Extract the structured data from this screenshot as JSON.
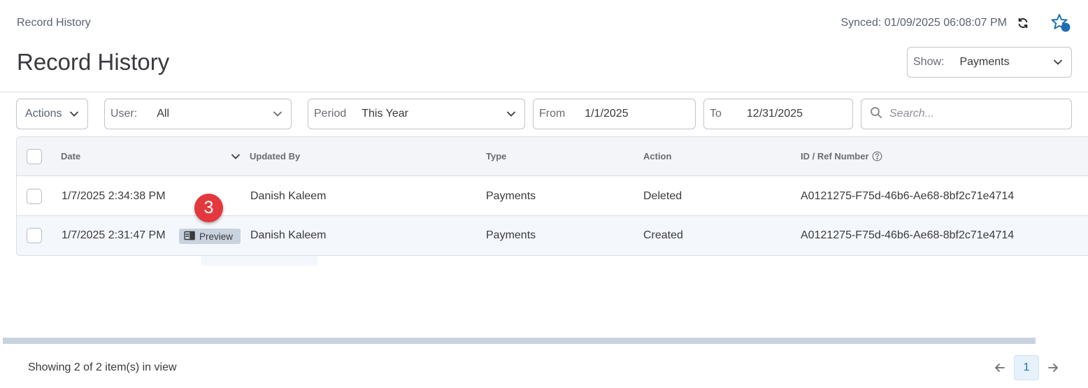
{
  "header": {
    "breadcrumb": "Record History",
    "synced": "Synced: 01/09/2025 06:08:07 PM",
    "title": "Record History"
  },
  "show": {
    "label": "Show:",
    "value": "Payments"
  },
  "filters": {
    "actions": "Actions",
    "user_label": "User:",
    "user_value": "All",
    "period_label": "Period",
    "period_value": "This Year",
    "from_label": "From",
    "from_value": "1/1/2025",
    "to_label": "To",
    "to_value": "12/31/2025",
    "search_placeholder": "Search..."
  },
  "table": {
    "columns": [
      "Date",
      "Updated By",
      "Type",
      "Action",
      "ID / Ref Number"
    ],
    "rows": [
      {
        "date": "1/7/2025 2:34:38 PM",
        "updated_by": "Danish Kaleem",
        "type": "Payments",
        "action": "Deleted",
        "ref": "A0121275-F75d-46b6-Ae68-8bf2c71e4714"
      },
      {
        "date": "1/7/2025 2:31:47 PM",
        "updated_by": "Danish Kaleem",
        "type": "Payments",
        "action": "Created",
        "ref": "A0121275-F75d-46b6-Ae68-8bf2c71e4714"
      }
    ],
    "preview_label": "Preview"
  },
  "step_badge": "3",
  "footer": {
    "showing": "Showing 2 of 2 item(s) in view",
    "page": "1"
  },
  "colors": {
    "accent": "#1f6fb2",
    "badge": "#e3383d",
    "header_bg": "#f4f5f8",
    "preview_bg": "#c9d3df"
  },
  "icons": [
    "sync-icon",
    "star-icon",
    "chevron-down-icon",
    "search-icon",
    "help-icon",
    "preview-panel-icon",
    "arrow-left-icon",
    "arrow-right-icon"
  ]
}
